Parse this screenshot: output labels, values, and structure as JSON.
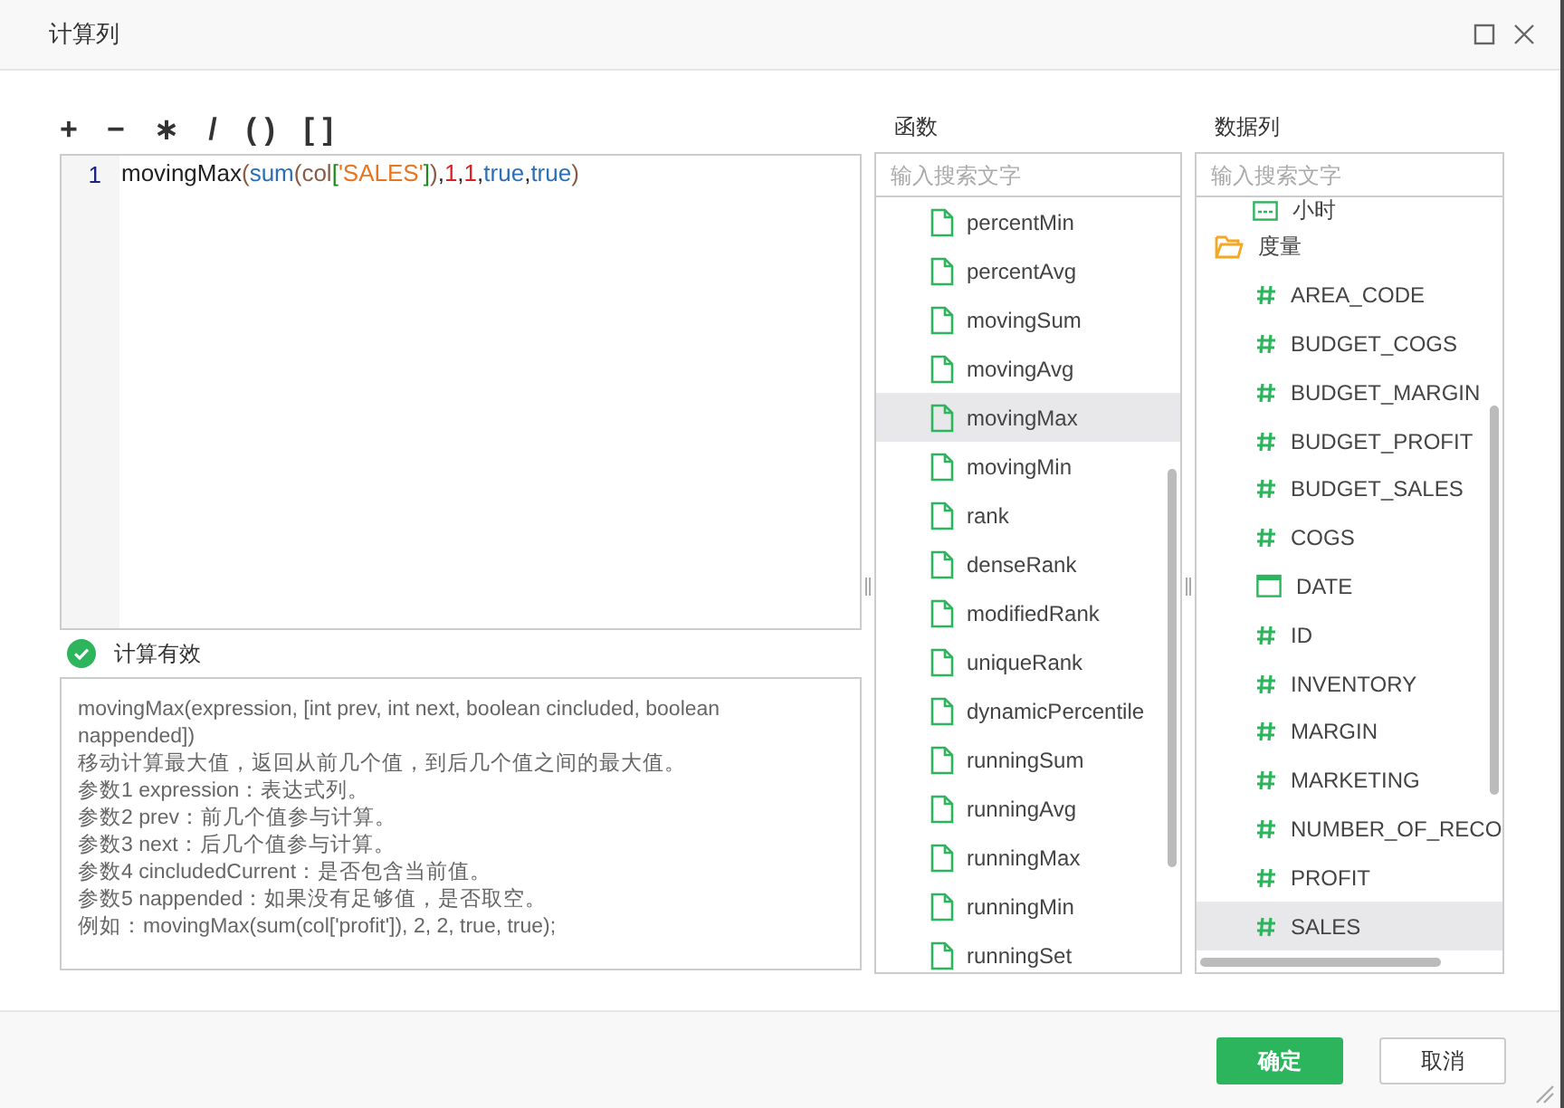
{
  "window": {
    "title": "计算列"
  },
  "operators": [
    "+",
    "−",
    "∗",
    "/",
    "( )",
    "[ ]"
  ],
  "editor": {
    "line_number": "1",
    "tokens": [
      {
        "text": "movingMax",
        "kind": "plain"
      },
      {
        "text": "(",
        "kind": "paren"
      },
      {
        "text": "sum",
        "kind": "func"
      },
      {
        "text": "(col",
        "kind": "paren"
      },
      {
        "text": "[",
        "kind": "bracket"
      },
      {
        "text": "'SALES'",
        "kind": "string"
      },
      {
        "text": "]",
        "kind": "bracket"
      },
      {
        "text": ")",
        "kind": "paren"
      },
      {
        "text": ",",
        "kind": "plain"
      },
      {
        "text": "1",
        "kind": "number"
      },
      {
        "text": ",",
        "kind": "plain"
      },
      {
        "text": "1",
        "kind": "number"
      },
      {
        "text": ",",
        "kind": "plain"
      },
      {
        "text": "true",
        "kind": "keyword"
      },
      {
        "text": ",",
        "kind": "plain"
      },
      {
        "text": "true",
        "kind": "keyword"
      },
      {
        "text": ")",
        "kind": "paren"
      }
    ]
  },
  "validation": {
    "valid": true,
    "message": "计算有效"
  },
  "description": [
    "movingMax(expression, [int prev, int next, boolean cincluded, boolean nappended])",
    "移动计算最大值，返回从前几个值，到后几个值之间的最大值。",
    "参数1 expression：表达式列。",
    "参数2 prev：前几个值参与计算。",
    "参数3 next：后几个值参与计算。",
    "参数4 cincludedCurrent：是否包含当前值。",
    "参数5 nappended：如果没有足够值，是否取空。",
    "例如：movingMax(sum(col['profit']), 2, 2, true, true);"
  ],
  "functions": {
    "label": "函数",
    "search": {
      "placeholder": "输入搜索文字"
    },
    "items": [
      {
        "name": "percentMin",
        "selected": false
      },
      {
        "name": "percentAvg",
        "selected": false
      },
      {
        "name": "movingSum",
        "selected": false
      },
      {
        "name": "movingAvg",
        "selected": false
      },
      {
        "name": "movingMax",
        "selected": true
      },
      {
        "name": "movingMin",
        "selected": false
      },
      {
        "name": "rank",
        "selected": false
      },
      {
        "name": "denseRank",
        "selected": false
      },
      {
        "name": "modifiedRank",
        "selected": false
      },
      {
        "name": "uniqueRank",
        "selected": false
      },
      {
        "name": "dynamicPercentile",
        "selected": false
      },
      {
        "name": "runningSum",
        "selected": false
      },
      {
        "name": "runningAvg",
        "selected": false
      },
      {
        "name": "runningMax",
        "selected": false
      },
      {
        "name": "runningMin",
        "selected": false
      },
      {
        "name": "runningSet",
        "selected": false
      }
    ]
  },
  "data_columns": {
    "label": "数据列",
    "search": {
      "placeholder": "输入搜索文字"
    },
    "items": [
      {
        "name": "小时",
        "kind": "date-part",
        "selected": false
      },
      {
        "name": "度量",
        "kind": "folder",
        "expanded": true,
        "selected": false,
        "children": [
          {
            "name": "AREA_CODE",
            "kind": "number",
            "selected": false
          },
          {
            "name": "BUDGET_COGS",
            "kind": "number",
            "selected": false
          },
          {
            "name": "BUDGET_MARGIN",
            "kind": "number",
            "selected": false
          },
          {
            "name": "BUDGET_PROFIT",
            "kind": "number",
            "selected": false
          },
          {
            "name": "BUDGET_SALES",
            "kind": "number",
            "selected": false
          },
          {
            "name": "COGS",
            "kind": "number",
            "selected": false
          },
          {
            "name": "DATE",
            "kind": "date",
            "selected": false
          },
          {
            "name": "ID",
            "kind": "number",
            "selected": false
          },
          {
            "name": "INVENTORY",
            "kind": "number",
            "selected": false
          },
          {
            "name": "MARGIN",
            "kind": "number",
            "selected": false
          },
          {
            "name": "MARKETING",
            "kind": "number",
            "selected": false
          },
          {
            "name": "NUMBER_OF_RECO",
            "kind": "number",
            "selected": false
          },
          {
            "name": "PROFIT",
            "kind": "number",
            "selected": false
          },
          {
            "name": "SALES",
            "kind": "number",
            "selected": true
          }
        ]
      }
    ]
  },
  "buttons": [
    {
      "label": "确定",
      "kind": "primary"
    },
    {
      "label": "取消",
      "kind": "secondary"
    }
  ]
}
